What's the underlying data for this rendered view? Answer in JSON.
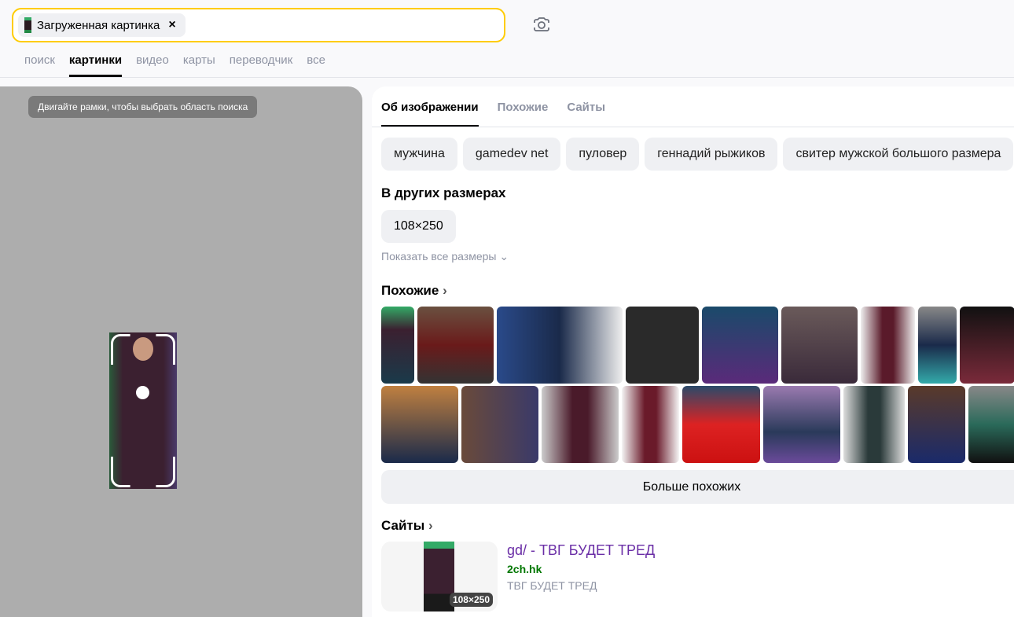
{
  "search": {
    "chip_label": "Загруженная картинка",
    "clear_icon": "×",
    "camera_icon": "camera-icon"
  },
  "nav": [
    "поиск",
    "картинки",
    "видео",
    "карты",
    "переводчик",
    "все"
  ],
  "left": {
    "tooltip": "Двигайте рамки, чтобы выбрать область поиска"
  },
  "tabs": [
    "Об изображении",
    "Похожие",
    "Сайты"
  ],
  "tags": [
    "мужчина",
    "gamedev net",
    "пуловер",
    "геннадий рыжиков",
    "свитер мужской большого размера"
  ],
  "sizes": {
    "title": "В других размерах",
    "items": [
      "108×250"
    ],
    "show_all": "Показать все размеры"
  },
  "similar": {
    "title": "Похожие",
    "more": "Больше похожих"
  },
  "sites": {
    "title": "Сайты",
    "items": [
      {
        "title_prefix": "gd/",
        "title": " - ТВГ БУДЕТ ТРЕД",
        "host": "2ch.hk",
        "desc": "ТВГ БУДЕТ ТРЕД",
        "size": "108×250"
      }
    ]
  }
}
